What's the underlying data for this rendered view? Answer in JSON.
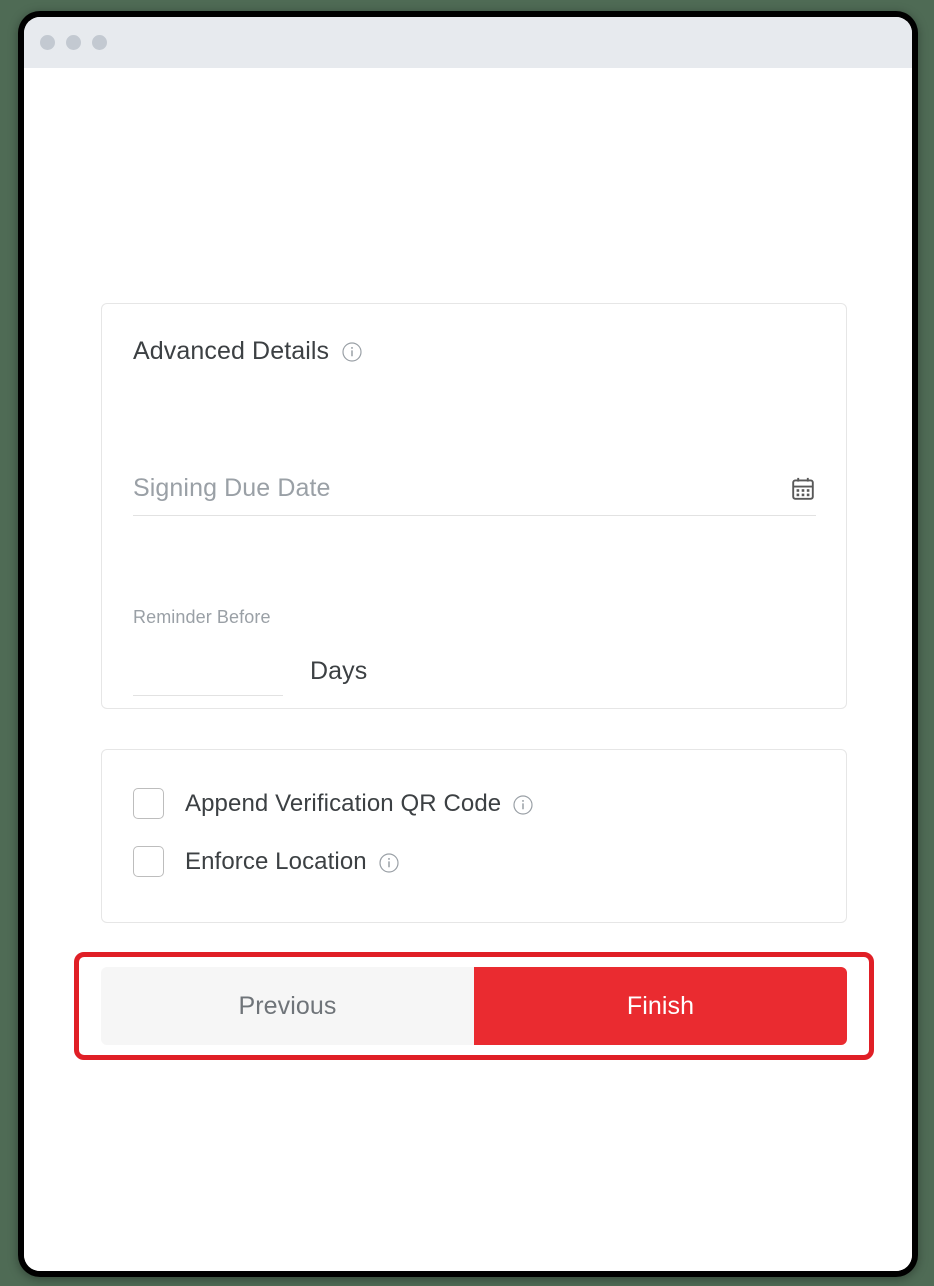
{
  "window": {
    "traffic_lights": [
      "close",
      "minimize",
      "maximize"
    ]
  },
  "advanced_card": {
    "heading": "Advanced Details",
    "heading_info_icon": "info-icon",
    "signing_due_date": {
      "placeholder": "Signing Due Date",
      "value": "",
      "icon": "calendar-icon"
    },
    "reminder": {
      "label": "Reminder Before",
      "value": "",
      "placeholder": "",
      "unit_label": "Days"
    }
  },
  "options_card": {
    "checkboxes": [
      {
        "label": "Append Verification QR Code",
        "checked": false,
        "info_icon": "info-icon"
      },
      {
        "label": "Enforce Location",
        "checked": false,
        "info_icon": "info-icon"
      }
    ]
  },
  "footer": {
    "previous_label": "Previous",
    "finish_label": "Finish"
  },
  "colors": {
    "accent_red": "#ea2b30",
    "annotation_red": "#e01f26",
    "titlebar": "#e7eaee",
    "page_background": "#ffffff",
    "outer_background": "#4f6b55",
    "muted_text": "#9aa0a6",
    "body_text": "#3c4043"
  }
}
